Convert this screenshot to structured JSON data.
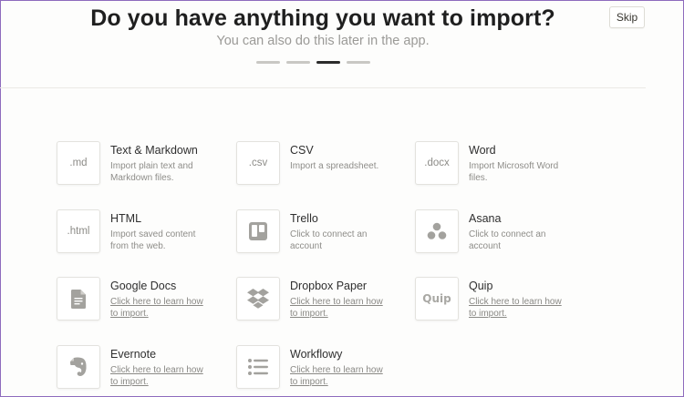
{
  "header": {
    "title": "Do you have anything you want to import?",
    "subtitle": "You can also do this later in the app.",
    "skip_label": "Skip"
  },
  "progress": {
    "steps": 4,
    "current": 3
  },
  "imports": [
    {
      "name": "Text & Markdown",
      "icon": ".md",
      "desc": "Import plain text and Markdown files.",
      "link": false
    },
    {
      "name": "CSV",
      "icon": ".csv",
      "desc": "Import a spreadsheet.",
      "link": false
    },
    {
      "name": "Word",
      "icon": ".docx",
      "desc": "Import Microsoft Word files.",
      "link": false
    },
    {
      "name": "HTML",
      "icon": ".html",
      "desc": "Import saved content from the web.",
      "link": false
    },
    {
      "name": "Trello",
      "icon": "trello-icon",
      "desc": "Click to connect an account",
      "link": false
    },
    {
      "name": "Asana",
      "icon": "asana-icon",
      "desc": "Click to connect an account",
      "link": false
    },
    {
      "name": "Google Docs",
      "icon": "google-docs-icon",
      "desc": "Click here to learn how to import.",
      "link": true
    },
    {
      "name": "Dropbox Paper",
      "icon": "dropbox-icon",
      "desc": "Click here to learn how to import.",
      "link": true
    },
    {
      "name": "Quip",
      "icon": "Quip",
      "desc": "Click here to learn how to import.",
      "link": true
    },
    {
      "name": "Evernote",
      "icon": "evernote-icon",
      "desc": "Click here to learn how to import.",
      "link": true
    },
    {
      "name": "Workflowy",
      "icon": "workflowy-icon",
      "desc": "Click here to learn how to import.",
      "link": true
    }
  ]
}
